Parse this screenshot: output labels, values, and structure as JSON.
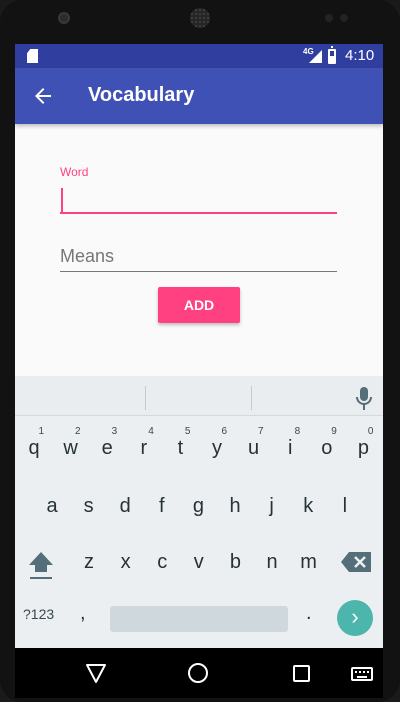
{
  "status_bar": {
    "time": "4:10",
    "network": "4G",
    "icons": [
      "sd-card-icon",
      "signal-icon",
      "battery-icon"
    ]
  },
  "app_bar": {
    "title": "Vocabulary",
    "nav_icon": "back-arrow-icon"
  },
  "form": {
    "word_label": "Word",
    "word_value": "",
    "means_placeholder": "Means",
    "means_value": "",
    "add_label": "ADD"
  },
  "keyboard": {
    "row1": [
      {
        "k": "q",
        "h": "1"
      },
      {
        "k": "w",
        "h": "2"
      },
      {
        "k": "e",
        "h": "3"
      },
      {
        "k": "r",
        "h": "4"
      },
      {
        "k": "t",
        "h": "5"
      },
      {
        "k": "y",
        "h": "6"
      },
      {
        "k": "u",
        "h": "7"
      },
      {
        "k": "i",
        "h": "8"
      },
      {
        "k": "o",
        "h": "9"
      },
      {
        "k": "p",
        "h": "0"
      }
    ],
    "row2": [
      "a",
      "s",
      "d",
      "f",
      "g",
      "h",
      "j",
      "k",
      "l"
    ],
    "row3": [
      "z",
      "x",
      "c",
      "v",
      "b",
      "n",
      "m"
    ],
    "symbols_label": "?123",
    "comma": ",",
    "period": ".",
    "enter_glyph": "›"
  },
  "colors": {
    "status_bar": "#303f9f",
    "app_bar": "#3f51b5",
    "accent": "#ff4081",
    "keyboard_bg": "#eceff1",
    "enter_key": "#4db6ac"
  },
  "nav_bar": {
    "icons": [
      "nav-back-icon",
      "nav-home-icon",
      "nav-recents-icon",
      "nav-keyboard-icon"
    ]
  }
}
